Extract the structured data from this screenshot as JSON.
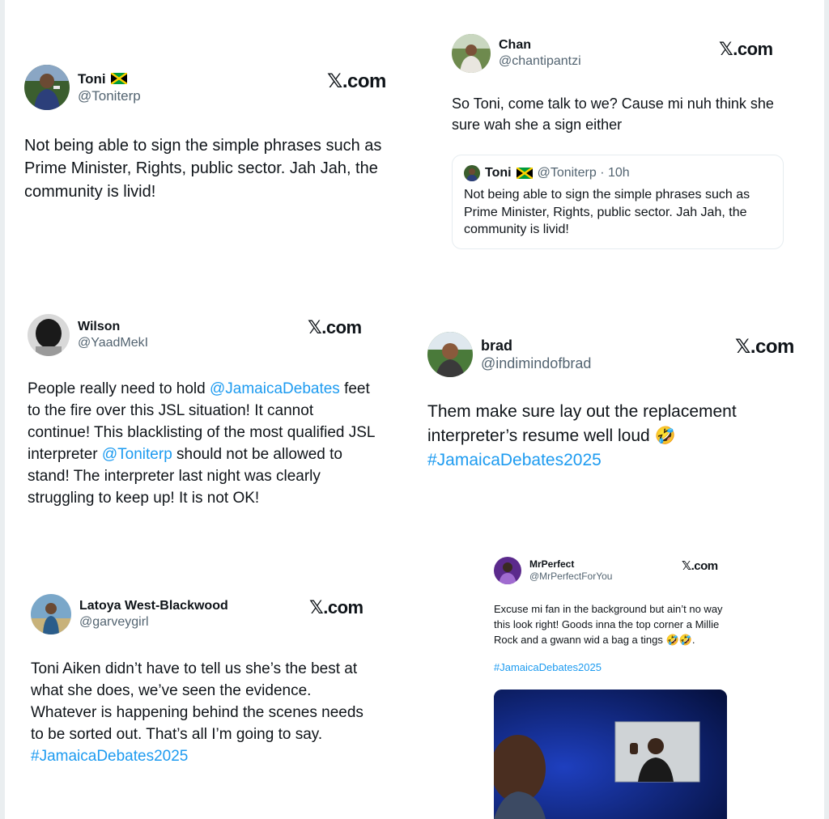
{
  "brand_label": ".com",
  "brand_glyph": "𝕏",
  "flag_icon": "jamaica-flag-icon",
  "colors": {
    "link": "#1d9bf0",
    "handle": "#536471",
    "text": "#0f1419"
  },
  "tweets": [
    {
      "name": "Toni",
      "handle": "@Toniterp",
      "text": "Not being able to sign the simple phrases such as Prime Minister, Rights, public sector. Jah Jah, the community is livid!"
    },
    {
      "name": "Chan",
      "handle": "@chantipantzi",
      "text": "So Toni, come talk to we? Cause mi nuh think she sure wah she a sign either",
      "quote": {
        "name": "Toni",
        "meta": "@Toniterp · 10h",
        "text": "Not being able to sign the simple phrases such as Prime Minister, Rights, public sector. Jah Jah, the community is livid!"
      }
    },
    {
      "name": "Wilson",
      "handle": "@YaadMekI",
      "text_parts": [
        "People really need to hold ",
        "@JamaicaDebates",
        " feet to the fire over this JSL situation! It cannot continue! This blacklisting of the most qualified JSL interpreter ",
        "@Toniterp",
        " should not be allowed to stand! The interpreter last night was clearly struggling to keep up! It is not OK!"
      ]
    },
    {
      "name": "brad",
      "handle": "@indimindofbrad",
      "text": "Them make sure lay out the replacement interpreter’s resume well loud 🤣",
      "hashtag": "#JamaicaDebates2025"
    },
    {
      "name": "Latoya West-Blackwood",
      "handle": "@garveygirl",
      "text": "Toni Aiken didn’t have to tell us she’s the best at what she does, we’ve seen the evidence. Whatever is happening behind the scenes needs to be sorted out. That’s all I’m going to say.",
      "hashtag": "#JamaicaDebates2025"
    },
    {
      "name": "MrPerfect",
      "handle": "@MrPerfectForYou",
      "text": "Excuse mi fan in the background but ain’t no way this look right! Goods inna the top corner a Millie Rock and a gwann wid a bag a tings 🤣🤣.",
      "hashtag": "#JamaicaDebates2025"
    }
  ]
}
